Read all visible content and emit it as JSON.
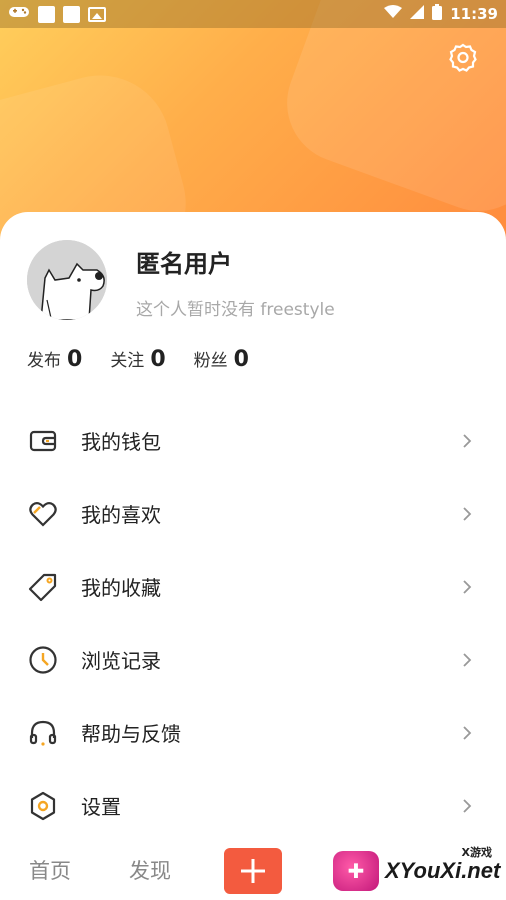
{
  "status_bar": {
    "time": "11:39"
  },
  "profile": {
    "username": "匿名用户",
    "bio": "这个人暂时没有 freestyle",
    "stats": [
      {
        "label": "发布",
        "value": "0"
      },
      {
        "label": "关注",
        "value": "0"
      },
      {
        "label": "粉丝",
        "value": "0"
      }
    ]
  },
  "menu": {
    "items": [
      {
        "label": "我的钱包",
        "icon": "wallet-icon"
      },
      {
        "label": "我的喜欢",
        "icon": "heart-icon"
      },
      {
        "label": "我的收藏",
        "icon": "tag-icon"
      },
      {
        "label": "浏览记录",
        "icon": "clock-icon"
      },
      {
        "label": "帮助与反馈",
        "icon": "headset-icon"
      },
      {
        "label": "设置",
        "icon": "settings-hex-icon"
      }
    ]
  },
  "bottom_nav": {
    "home": "首页",
    "discover": "发现",
    "add": "add-icon"
  },
  "watermark": {
    "text": "XYouXi.net",
    "tag": "X游戏"
  },
  "colors": {
    "accent": "#ff9a3d",
    "add_button": "#f35b3f",
    "icon_accent": "#f5a623"
  }
}
